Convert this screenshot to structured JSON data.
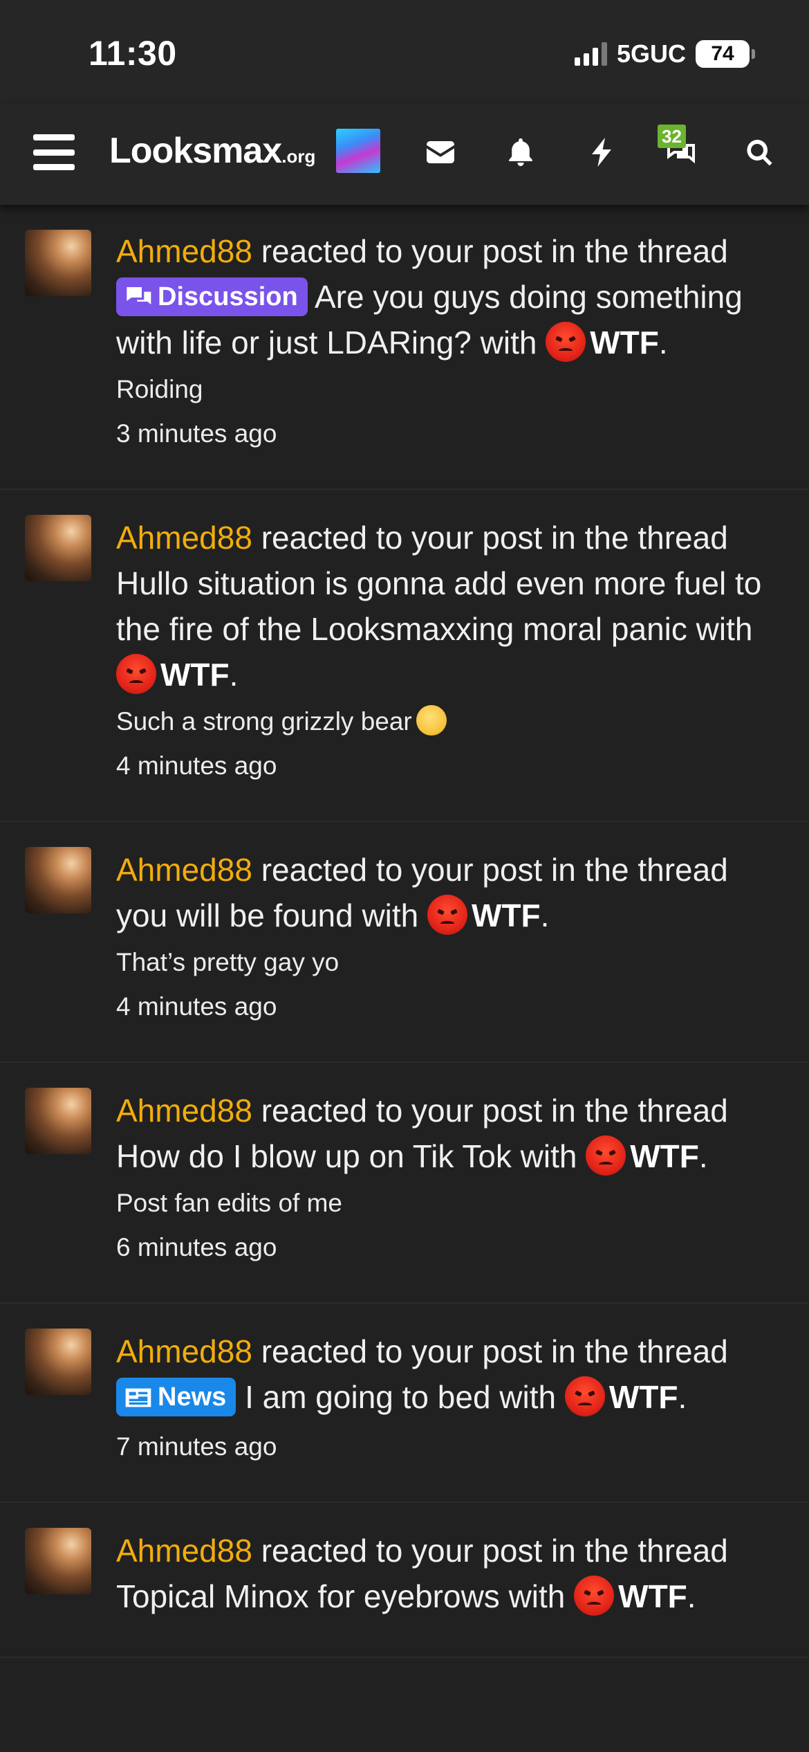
{
  "status_bar": {
    "time": "11:30",
    "network": "5GUC",
    "battery": "74"
  },
  "nav": {
    "logo_main": "Looksmax",
    "logo_tld": ".org",
    "chat_badge": "32"
  },
  "feed": [
    {
      "user": "Ahmed88",
      "verb": "reacted to your post in the thread",
      "prefix": "Discussion",
      "thread": "Are you guys doing something with life or just LDARing? with",
      "reaction": "WTF",
      "snippet": "Roiding",
      "time": "3 minutes ago"
    },
    {
      "user": "Ahmed88",
      "verb": "reacted to your post in the thread",
      "thread": "Hullo situation is gonna add even more fuel to the fire of the Looksmaxxing moral panic with",
      "reaction": "WTF",
      "snippet": "Such a strong grizzly bear",
      "time": "4 minutes ago"
    },
    {
      "user": "Ahmed88",
      "verb": "reacted to your post in the thread",
      "thread": "you will be found with",
      "reaction": "WTF",
      "snippet": "That’s pretty gay yo",
      "time": "4 minutes ago"
    },
    {
      "user": "Ahmed88",
      "verb": "reacted to your post in the thread",
      "thread": "How do I blow up on Tik Tok with",
      "reaction": "WTF",
      "snippet": "Post fan edits of me",
      "time": "6 minutes ago"
    },
    {
      "user": "Ahmed88",
      "verb": "reacted to your post in the thread",
      "prefix": "News",
      "thread": "I am going to bed with",
      "reaction": "WTF",
      "time": "7 minutes ago"
    },
    {
      "user": "Ahmed88",
      "verb": "reacted to your post in the thread",
      "thread": "Topical Minox for eyebrows with",
      "reaction": "WTF"
    }
  ],
  "punct": "."
}
